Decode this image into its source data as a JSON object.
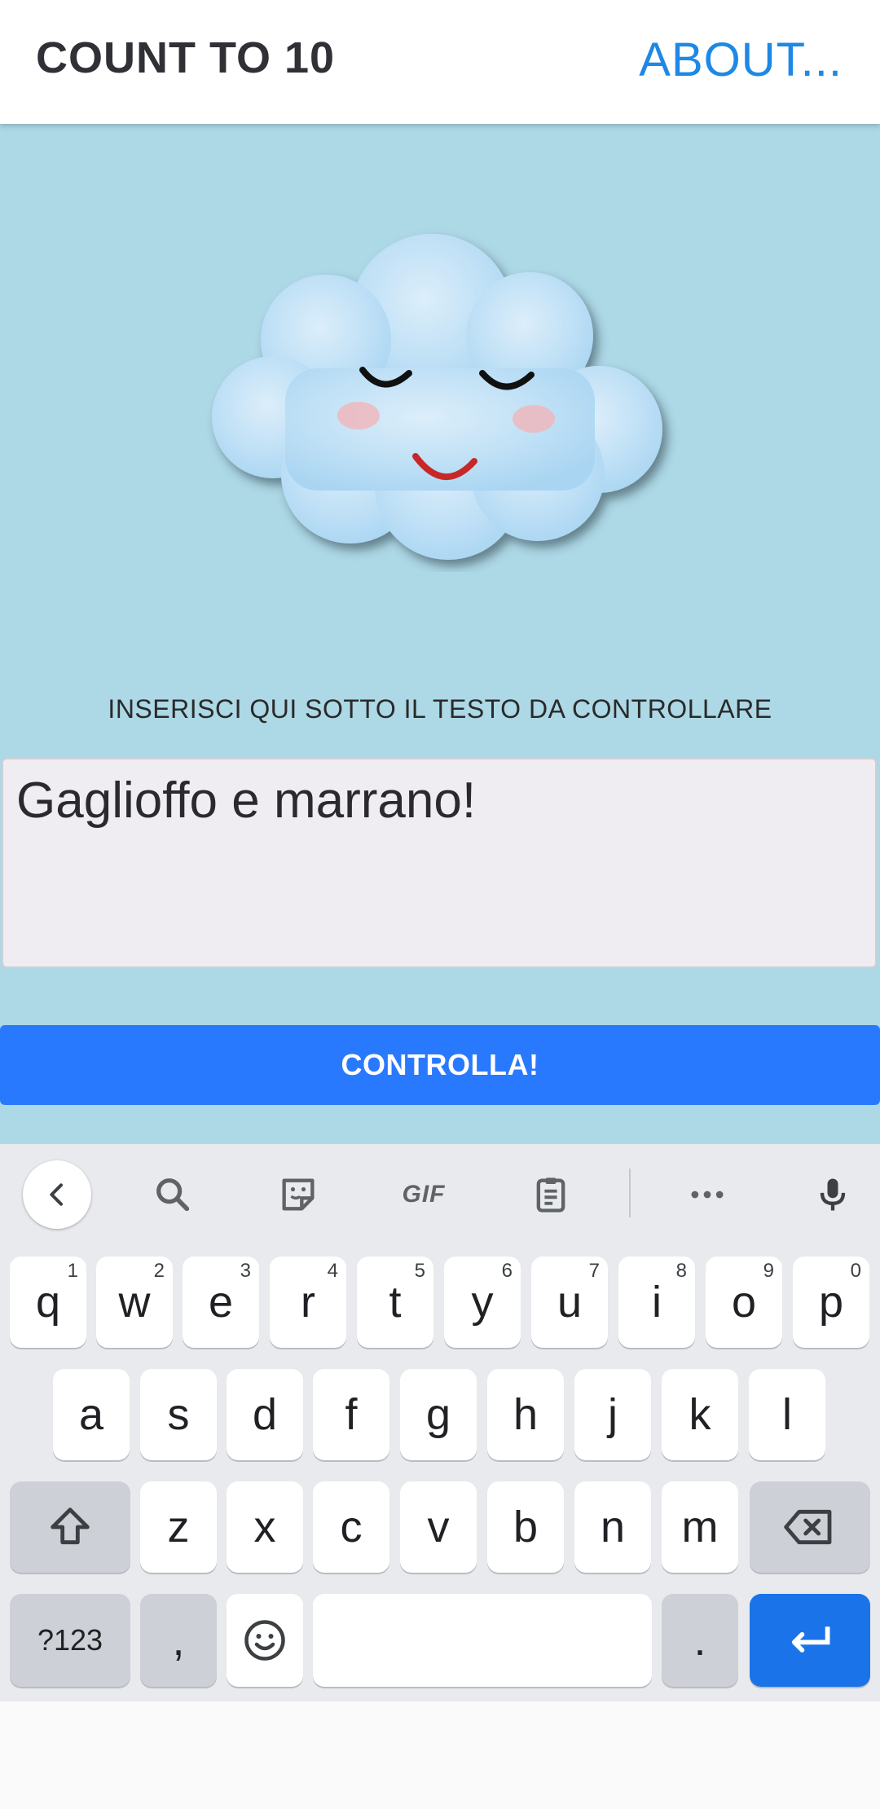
{
  "app": {
    "title": "COUNT TO 10",
    "about_label": "ABOUT...",
    "accent_color": "#1e88e5",
    "background_color": "#add8e6"
  },
  "main": {
    "mascot_icon": "sleeping-cloud-icon",
    "instruction": "INSERISCI QUI SOTTO IL TESTO DA CONTROLLARE",
    "text_value": "Gaglioffo e marrano!",
    "check_button_label": "CONTROLLA!",
    "button_color": "#2979ff"
  },
  "keyboard": {
    "toolbar": {
      "icons": [
        "back-chevron-icon",
        "search-icon",
        "sticker-icon",
        "gif-icon",
        "clipboard-icon",
        "more-icon",
        "microphone-icon"
      ],
      "gif_label": "GIF"
    },
    "row1": [
      {
        "key": "q",
        "hint": "1"
      },
      {
        "key": "w",
        "hint": "2"
      },
      {
        "key": "e",
        "hint": "3"
      },
      {
        "key": "r",
        "hint": "4"
      },
      {
        "key": "t",
        "hint": "5"
      },
      {
        "key": "y",
        "hint": "6"
      },
      {
        "key": "u",
        "hint": "7"
      },
      {
        "key": "i",
        "hint": "8"
      },
      {
        "key": "o",
        "hint": "9"
      },
      {
        "key": "p",
        "hint": "0"
      }
    ],
    "row2": [
      "a",
      "s",
      "d",
      "f",
      "g",
      "h",
      "j",
      "k",
      "l"
    ],
    "row3": [
      "z",
      "x",
      "c",
      "v",
      "b",
      "n",
      "m"
    ],
    "bottom": {
      "symbols_label": "?123",
      "comma_label": ",",
      "period_label": "."
    }
  }
}
